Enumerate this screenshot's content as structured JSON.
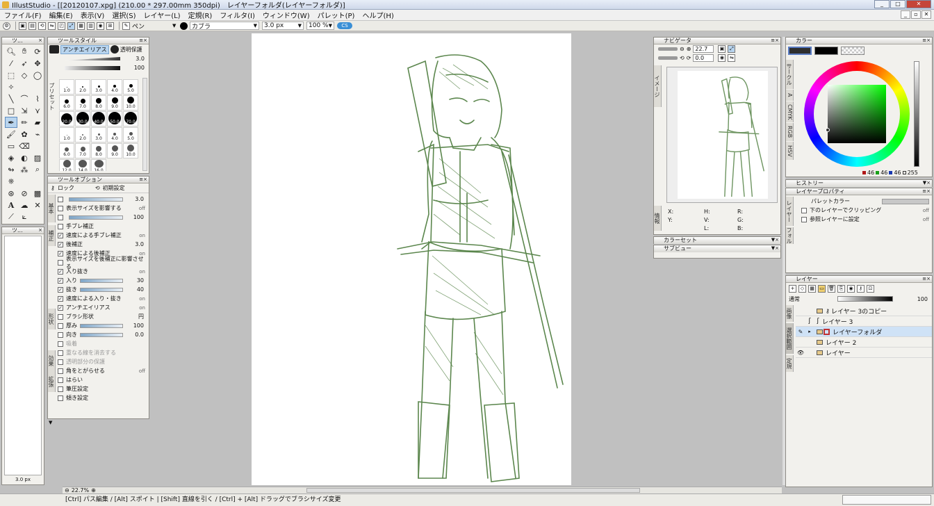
{
  "window": {
    "title": "IllustStudio - [[20120107.xpg] (210.00 * 297.00mm 350dpi)　レイヤーフォルダ(レイヤーフォルダ)]"
  },
  "menu": [
    "ファイル(F)",
    "編集(E)",
    "表示(V)",
    "選択(S)",
    "レイヤー(L)",
    "定規(R)",
    "フィルタ(I)",
    "ウィンドウ(W)",
    "パレット(P)",
    "ヘルプ(H)"
  ],
  "toolbar": {
    "tool_name": "ペン",
    "brush_name": "カブラ",
    "brush_size": "3.0 px",
    "opacity": "100 %"
  },
  "tools_panel": {
    "title": "ツ..."
  },
  "tool_style": {
    "title": "ツールスタイル",
    "mode_tab": "アンチエイリアス",
    "transparent_tab": "透明保護",
    "val1": "3.0",
    "val2": "100",
    "preset_label": "プリセット",
    "presets": [
      "1.0",
      "2.0",
      "3.0",
      "4.0",
      "5.0",
      "6.0",
      "7.0",
      "8.0",
      "9.0",
      "10.0",
      "20.0",
      "30.0",
      "40.0",
      "50.0",
      "70.0",
      "1.0",
      "2.0",
      "3.0",
      "4.0",
      "5.0",
      "6.0",
      "7.0",
      "8.0",
      "9.0",
      "10.0",
      "12.0",
      "14.0",
      "16.0"
    ]
  },
  "tool_options": {
    "title": "ツールオプション",
    "lock": "ロック",
    "reset": "初期設定",
    "tabs": [
      "基本",
      "補正",
      "形状",
      "効果",
      "拡張"
    ],
    "rows": [
      {
        "label": "",
        "value": "3.0",
        "cb": false
      },
      {
        "label": "表示サイズを影響する",
        "value": "off",
        "cb": false
      },
      {
        "label": "",
        "value": "100",
        "cb": false
      },
      {
        "label": "手ブレ補正",
        "value": "",
        "cb": false
      },
      {
        "label": "速度による手ブレ補正",
        "value": "on",
        "cb": true
      },
      {
        "label": "後補正",
        "value": "3.0",
        "cb": true
      },
      {
        "label": "速度による後補正",
        "value": "on",
        "cb": true
      },
      {
        "label": "表示サイズを後補正に影響させる",
        "value": "",
        "cb": false
      },
      {
        "label": "入り抜き",
        "value": "on",
        "cb": true
      },
      {
        "label": "入り",
        "value": "30",
        "cb": true
      },
      {
        "label": "抜き",
        "value": "40",
        "cb": true
      },
      {
        "label": "速度による入り・抜き",
        "value": "on",
        "cb": true
      },
      {
        "label": "アンチエイリアス",
        "value": "on",
        "cb": true
      },
      {
        "label": "ブラシ形状",
        "value": "円",
        "cb": false
      },
      {
        "label": "厚み",
        "value": "100",
        "cb": false
      },
      {
        "label": "向き",
        "value": "0.0",
        "cb": false
      },
      {
        "label": "吸着",
        "value": "",
        "cb": false
      },
      {
        "label": "重なる線を消去する",
        "value": "",
        "cb": false
      },
      {
        "label": "透明部分の保護",
        "value": "",
        "cb": false
      },
      {
        "label": "角をとがらせる",
        "value": "off",
        "cb": false
      },
      {
        "label": "はらい",
        "value": "",
        "cb": false
      },
      {
        "label": "筆圧設定",
        "value": "",
        "cb": false
      },
      {
        "label": "傾き設定",
        "value": "",
        "cb": false
      }
    ]
  },
  "small_panel": {
    "title": "ツ...",
    "value": "3.0 px"
  },
  "navigator": {
    "title": "ナビゲータ",
    "zoom": "22.7",
    "rotation": "0.0",
    "side_tab": "イメージ",
    "info_tab": "情報",
    "info": [
      "X:",
      "Y:",
      "H:",
      "V:",
      "L:",
      "R:",
      "G:",
      "B:"
    ]
  },
  "color_set": {
    "title": "カラーセット"
  },
  "sub_view": {
    "title": "サブビュー"
  },
  "color": {
    "title": "カラー",
    "tabs": [
      "サークル",
      "A",
      "CMYK",
      "RGB",
      "HSV"
    ],
    "values": [
      "46",
      "46",
      "46",
      "255"
    ]
  },
  "history": {
    "title": "ヒストリー"
  },
  "layer_property": {
    "title": "レイヤープロパティ",
    "tabs": [
      "レイヤー",
      "フォル"
    ],
    "palette_color": "パレットカラー",
    "clip": "下のレイヤーでクリッピング",
    "ref": "参照レイヤーに設定",
    "off1": "off",
    "off2": "off"
  },
  "layers": {
    "title": "レイヤー",
    "blend": "通常",
    "opacity": "100",
    "tabs": [
      "画像",
      "選択範囲",
      "定規"
    ],
    "items": [
      {
        "name": "レイヤー 3のコピー"
      },
      {
        "name": "レイヤー 3"
      },
      {
        "name": "レイヤーフォルダ"
      },
      {
        "name": "レイヤー 2"
      },
      {
        "name": "レイヤー"
      }
    ]
  },
  "canvas_footer": {
    "zoom": "22.7%"
  },
  "statusbar": {
    "hint": "[Ctrl] パス編集 / [Alt] スポイト | [Shift] 直線を引く / [Ctrl] + [Alt] ドラッグでブラシサイズ変更"
  }
}
